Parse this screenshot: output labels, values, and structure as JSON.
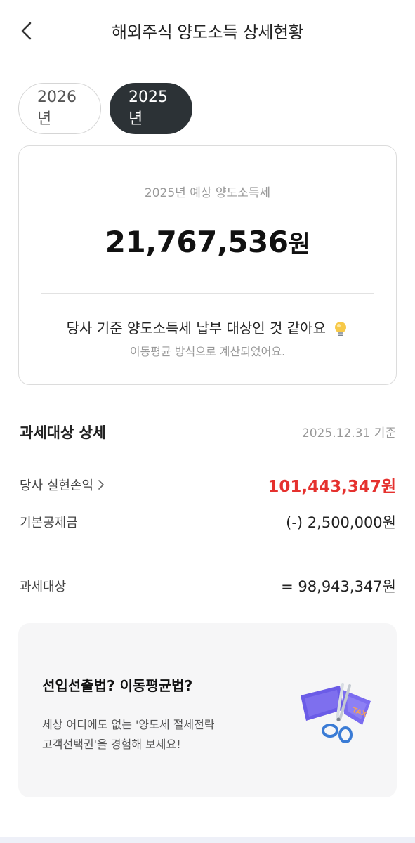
{
  "header": {
    "title": "해외주식 양도소득 상세현황",
    "back_icon": "chevron-left-icon"
  },
  "tabs": [
    {
      "label": "2026년",
      "selected": false
    },
    {
      "label": "2025년",
      "selected": true
    }
  ],
  "summary": {
    "label": "2025년 예상 양도소득세",
    "amount": "21,767,536",
    "amount_unit": "원",
    "message": "당사 기준 양도소득세 납부 대상인 것 같아요",
    "message_icon": "lightbulb-icon",
    "sub_message": "이동평균 방식으로 계산되었어요."
  },
  "detail": {
    "title": "과세대상 상세",
    "date": "2025.12.31 기준",
    "rows": [
      {
        "label": "당사 실현손익",
        "value": "101,443,347원",
        "color": "#e5312e",
        "has_chevron": true
      },
      {
        "label": "기본공제금",
        "value": "(-) 2,500,000원"
      },
      {
        "label": "과세대상",
        "value": "= 98,943,347원"
      }
    ]
  },
  "promo": {
    "title": "선입선출법? 이동평균법?",
    "desc_line1": "세상 어디에도 없는 '양도세 절세전략",
    "desc_line2": "고객선택권'을 경험해 보세요!",
    "illustration": "scissors-cutting-tax-bill-icon",
    "illustration_text": "TAX"
  },
  "colors": {
    "accent_dark": "#2c3236",
    "profit_red": "#e5312e",
    "promo_bg": "#f6f6f7"
  }
}
